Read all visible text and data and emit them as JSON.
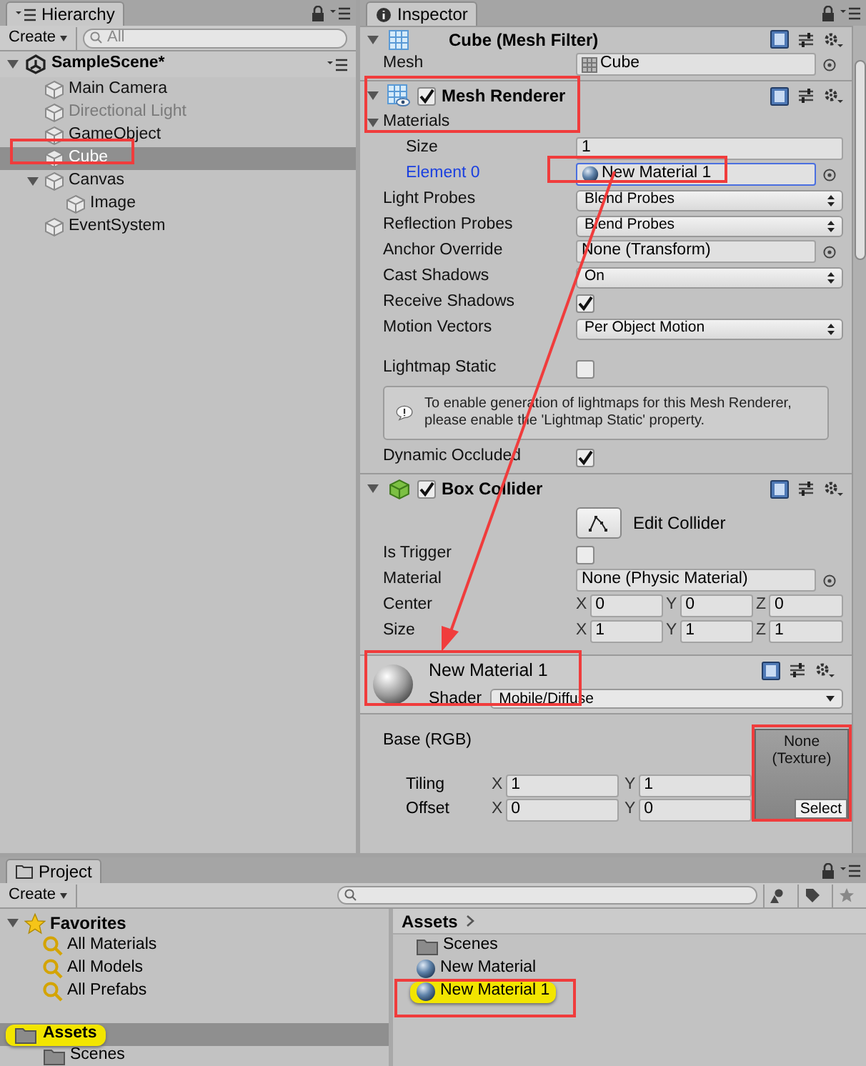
{
  "hierarchy": {
    "tab": "Hierarchy",
    "create": "Create",
    "search_placeholder": "All",
    "scene": {
      "name": "SampleScene*",
      "expanded": true
    },
    "items": [
      {
        "label": "Main Camera",
        "selected": false,
        "active": true
      },
      {
        "label": "Directional Light",
        "selected": false,
        "active": false
      },
      {
        "label": "GameObject",
        "selected": false,
        "active": true
      },
      {
        "label": "Cube",
        "selected": true,
        "active": true
      },
      {
        "label": "Canvas",
        "selected": false,
        "active": true,
        "expanded": true,
        "children": [
          {
            "label": "Image",
            "selected": false,
            "active": true
          }
        ]
      },
      {
        "label": "EventSystem",
        "selected": false,
        "active": true
      }
    ]
  },
  "inspector": {
    "tab": "Inspector",
    "components": [
      {
        "kind": "mesh_filter",
        "title": "Cube (Mesh Filter)",
        "rows": [
          {
            "kind": "object",
            "label": "Mesh",
            "value": "Cube",
            "asset": {
              "kind": "mesh"
            },
            "focused": false
          }
        ]
      },
      {
        "kind": "mesh_renderer",
        "title": "Mesh Renderer",
        "enabled": true,
        "rows": [
          {
            "kind": "foldout",
            "label": "Materials",
            "expanded": true,
            "children": [
              {
                "kind": "text",
                "label": "Size",
                "value": "1"
              },
              {
                "kind": "object",
                "label": "Element 0",
                "value": "New Material 1",
                "asset": {
                  "kind": "material"
                },
                "focused": true
              }
            ]
          },
          {
            "kind": "dropdown",
            "label": "Light Probes",
            "value": "Blend Probes"
          },
          {
            "kind": "dropdown",
            "label": "Reflection Probes",
            "value": "Blend Probes"
          },
          {
            "kind": "object",
            "label": "Anchor Override",
            "value": "None (Transform)",
            "focused": false
          },
          {
            "kind": "dropdown",
            "label": "Cast Shadows",
            "value": "On"
          },
          {
            "kind": "checkbox",
            "label": "Receive Shadows",
            "checked": true
          },
          {
            "kind": "dropdown",
            "label": "Motion Vectors",
            "value": "Per Object Motion"
          },
          {
            "kind": "spacer"
          },
          {
            "kind": "checkbox",
            "label": "Lightmap Static",
            "checked": false
          },
          {
            "kind": "help",
            "text": "To enable generation of lightmaps for this Mesh Renderer, please enable the 'Lightmap Static' property."
          },
          {
            "kind": "checkbox",
            "label": "Dynamic Occluded",
            "checked": true
          }
        ]
      },
      {
        "kind": "box_collider",
        "title": "Box Collider",
        "enabled": true,
        "rows": [
          {
            "kind": "button",
            "label": "Edit Collider"
          },
          {
            "kind": "checkbox",
            "label": "Is Trigger",
            "checked": false
          },
          {
            "kind": "object",
            "label": "Material",
            "value": "None (Physic Material)",
            "focused": false
          },
          {
            "kind": "vector3",
            "label": "Center",
            "fields": [
              {
                "axis": "X",
                "value": "0"
              },
              {
                "axis": "Y",
                "value": "0"
              },
              {
                "axis": "Z",
                "value": "0"
              }
            ]
          },
          {
            "kind": "vector3",
            "label": "Size",
            "fields": [
              {
                "axis": "X",
                "value": "1"
              },
              {
                "axis": "Y",
                "value": "1"
              },
              {
                "axis": "Z",
                "value": "1"
              }
            ]
          }
        ]
      }
    ],
    "material": {
      "name": "New Material 1",
      "shader_label": "Shader",
      "shader": "Mobile/Diffuse",
      "property": "Base (RGB)",
      "texture": "None (Texture)",
      "select": "Select",
      "vectors": [
        {
          "label": "Tiling",
          "fields": [
            {
              "axis": "X",
              "value": "1"
            },
            {
              "axis": "Y",
              "value": "1"
            }
          ]
        },
        {
          "label": "Offset",
          "fields": [
            {
              "axis": "X",
              "value": "0"
            },
            {
              "axis": "Y",
              "value": "0"
            }
          ]
        }
      ]
    }
  },
  "project": {
    "tab": "Project",
    "create": "Create",
    "favorites": {
      "label": "Favorites",
      "expanded": true,
      "items": [
        "All Materials",
        "All Models",
        "All Prefabs"
      ]
    },
    "tree": [
      {
        "label": "Assets",
        "highlighted": true,
        "children": [
          {
            "label": "Scenes",
            "highlighted": false
          }
        ]
      }
    ],
    "breadcrumb": "Assets",
    "assets": [
      {
        "kind": "folder",
        "label": "Scenes",
        "highlighted": false
      },
      {
        "kind": "material",
        "label": "New Material",
        "highlighted": false
      },
      {
        "kind": "material",
        "label": "New Material 1",
        "highlighted": true
      }
    ]
  }
}
